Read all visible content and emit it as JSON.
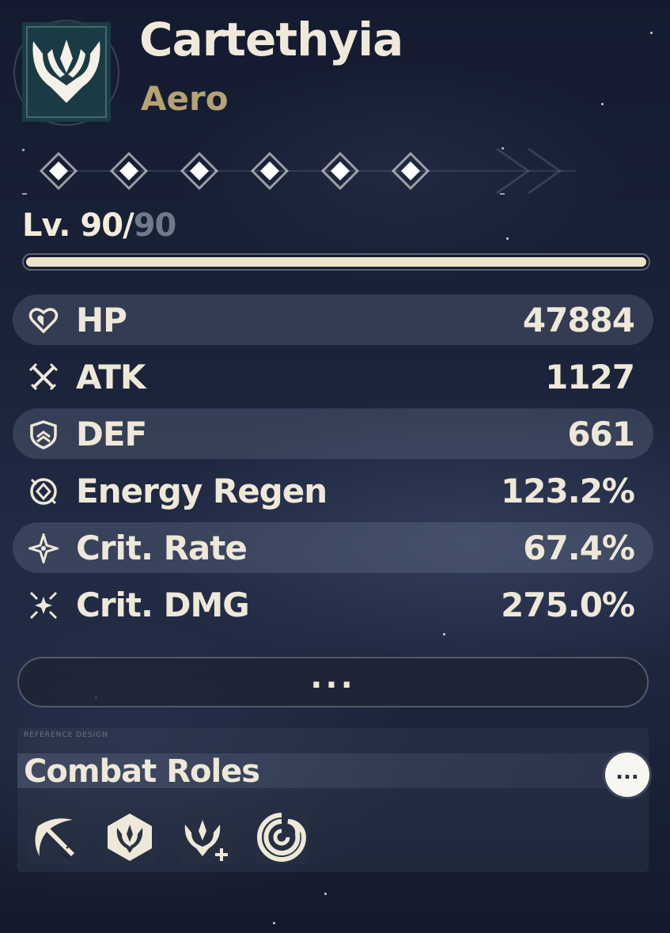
{
  "character": {
    "name": "Cartethyia",
    "element": "Aero",
    "emblem_icon": "aero-emblem-icon",
    "accent_color": "#b6a273"
  },
  "sequence": {
    "nodes": [
      {
        "icon": "diamond-icon",
        "unlocked": true
      },
      {
        "icon": "diamond-icon",
        "unlocked": true
      },
      {
        "icon": "diamond-icon",
        "unlocked": true
      },
      {
        "icon": "diamond-icon",
        "unlocked": true
      },
      {
        "icon": "diamond-icon",
        "unlocked": true
      },
      {
        "icon": "diamond-icon",
        "unlocked": true
      }
    ]
  },
  "level": {
    "prefix": "Lv. 90/",
    "max": "90",
    "progress": 1.0
  },
  "stats": [
    {
      "icon": "heart-icon",
      "label": "HP",
      "value": "47884",
      "shaded": true
    },
    {
      "icon": "crossed-swords-icon",
      "label": "ATK",
      "value": "1127",
      "shaded": false
    },
    {
      "icon": "shield-icon",
      "label": "DEF",
      "value": "661",
      "shaded": true
    },
    {
      "icon": "energy-regen-icon",
      "label": "Energy Regen",
      "value": "123.2%",
      "shaded": false
    },
    {
      "icon": "sparkle-icon",
      "label": "Crit. Rate",
      "value": "67.4%",
      "shaded": true
    },
    {
      "icon": "multi-sparkle-icon",
      "label": "Crit. DMG",
      "value": "275.0%",
      "shaded": false
    }
  ],
  "more_button": {
    "label": "..."
  },
  "combat_roles": {
    "tag": "REFERENCE DESIGN",
    "title": "Combat Roles",
    "info_button_label": "...",
    "roles": [
      {
        "icon": "slash-blade-icon"
      },
      {
        "icon": "hexagon-emblem-icon"
      },
      {
        "icon": "emblem-plus-icon"
      },
      {
        "icon": "swirl-icon"
      }
    ]
  }
}
